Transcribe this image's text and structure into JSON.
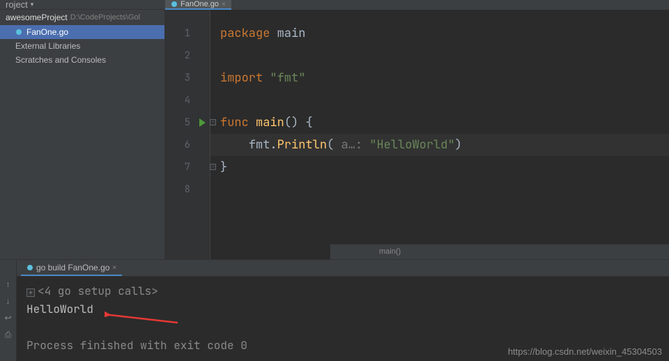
{
  "toolbar": {
    "project_label": "roject"
  },
  "project": {
    "name": "awesomeProject",
    "path": "D:\\CodeProjects\\Gol"
  },
  "tree": {
    "selected_file": "FanOne.go",
    "external_libs": "External Libraries",
    "scratches": "Scratches and Consoles"
  },
  "tab": {
    "label": "FanOne.go"
  },
  "gutter": {
    "lines": [
      "1",
      "2",
      "3",
      "4",
      "5",
      "6",
      "7",
      "8"
    ]
  },
  "code": {
    "l1_kw": "package ",
    "l1_id": "main",
    "l3_kw": "import ",
    "l3_str": "\"fmt\"",
    "l5_kw": "func ",
    "l5_fn": "main",
    "l5_rest": "() {",
    "l6_indent": "    ",
    "l6_a": "fmt",
    "l6_dot": ".",
    "l6_fn": "Println",
    "l6_open": "( ",
    "l6_hint": "a…: ",
    "l6_str": "\"HelloWorld\"",
    "l6_close": ")",
    "l7": "}"
  },
  "breadcrumb": {
    "text": "main()"
  },
  "run": {
    "tab_label": "go build FanOne.go",
    "line1": "<4 go setup calls>",
    "line2": "HelloWorld",
    "line3": "Process finished with exit code 0"
  },
  "watermark": "https://blog.csdn.net/weixin_45304503"
}
